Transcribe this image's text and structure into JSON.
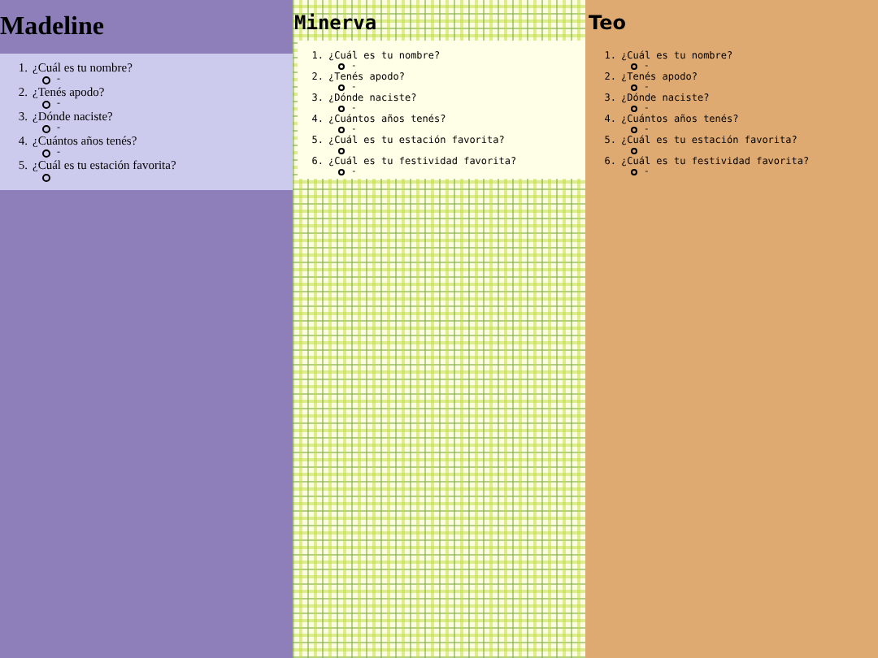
{
  "columns": [
    {
      "kind": "lavender",
      "title": "Madeline",
      "questions": [
        {
          "number": "1.",
          "text": "¿Cuál es tu nombre?",
          "answer": "-"
        },
        {
          "number": "2.",
          "text": "¿Tenés apodo?",
          "answer": "-"
        },
        {
          "number": "3.",
          "text": "¿Dónde naciste?",
          "answer": "-"
        },
        {
          "number": "4.",
          "text": "¿Cuántos años tenés?",
          "answer": "-"
        },
        {
          "number": "5.",
          "text": "¿Cuál es tu estación favorita?"
        }
      ]
    },
    {
      "kind": "plaid",
      "title": "Minerva",
      "questions": [
        {
          "number": "1.",
          "text": "¿Cuál es tu nombre?",
          "answer": "-"
        },
        {
          "number": "2.",
          "text": "¿Tenés apodo?",
          "answer": "-"
        },
        {
          "number": "3.",
          "text": "¿Dónde naciste?",
          "answer": "-"
        },
        {
          "number": "4.",
          "text": "¿Cuántos años tenés?",
          "answer": "-"
        },
        {
          "number": "5.",
          "text": "¿Cuál es tu estación favorita?"
        },
        {
          "number": "6.",
          "text": "¿Cuál es tu festividad favorita?",
          "answer": "-"
        }
      ]
    },
    {
      "kind": "orange",
      "title": "Teo",
      "questions": [
        {
          "number": "1.",
          "text": "¿Cuál es tu nombre?",
          "answer": "-"
        },
        {
          "number": "2.",
          "text": "¿Tenés apodo?",
          "answer": "-"
        },
        {
          "number": "3.",
          "text": "¿Dónde naciste?",
          "answer": "-"
        },
        {
          "number": "4.",
          "text": "¿Cuántos años tenés?",
          "answer": "-"
        },
        {
          "number": "5.",
          "text": "¿Cuál es tu estación favorita?"
        },
        {
          "number": "6.",
          "text": "¿Cuál es tu festividad favorita?",
          "answer": "-"
        }
      ]
    }
  ]
}
